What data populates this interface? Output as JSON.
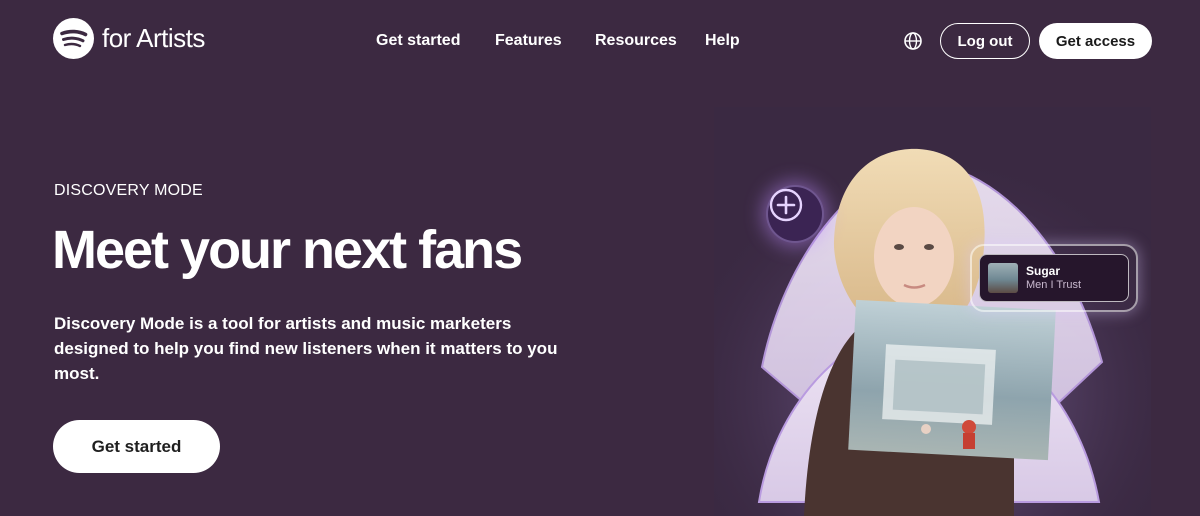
{
  "brand": {
    "logo_text": "for Artists"
  },
  "nav": {
    "items": [
      "Get started",
      "Features",
      "Resources",
      "Help"
    ]
  },
  "header": {
    "globe_icon": "globe-icon",
    "logout_label": "Log out",
    "access_label": "Get access"
  },
  "hero": {
    "eyebrow": "DISCOVERY MODE",
    "headline": "Meet your next fans",
    "description": "Discovery Mode is a tool for artists and music marketers designed to help you find new listeners when it matters to you most.",
    "cta_label": "Get started"
  },
  "artwork": {
    "track_title": "Sugar",
    "track_artist": "Men I Trust",
    "plus_icon": "plus-icon"
  },
  "colors": {
    "background": "#3c2941",
    "accent_glow": "#be8cff",
    "button": "#ffffff"
  }
}
